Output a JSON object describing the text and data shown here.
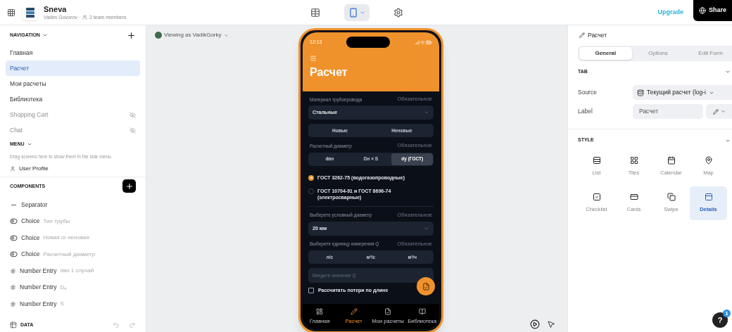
{
  "header": {
    "app_name": "Sneva",
    "owner": "Vadim Govorov ·",
    "team": "2 team members",
    "view_tools": [
      {
        "kind": "table",
        "selected": false
      },
      {
        "kind": "phone",
        "selected": true
      },
      {
        "kind": "gear",
        "selected": false
      }
    ],
    "upgrade": "Upgrade",
    "share": "Share"
  },
  "sidebar": {
    "navigation": {
      "title": "NAVIGATION",
      "items": [
        {
          "label": "Главная",
          "selected": false,
          "hidden": false
        },
        {
          "label": "Расчет",
          "selected": true,
          "hidden": false
        },
        {
          "label": "Мои расчеты",
          "selected": false,
          "hidden": false
        },
        {
          "label": "Библиотека",
          "selected": false,
          "hidden": false
        },
        {
          "label": "Shopping Cart",
          "selected": false,
          "hidden": true
        },
        {
          "label": "Chat",
          "selected": false,
          "hidden": true
        }
      ]
    },
    "menu": {
      "title": "MENU",
      "hint": "Drag screens here to show them in the side menu.",
      "items": [
        "User Profile"
      ]
    },
    "components": {
      "title": "COMPONENTS",
      "items": [
        {
          "kind": "separator",
          "label": "Separator"
        },
        {
          "kind": "choice",
          "label": "Choice",
          "detail": "Тип трубы"
        },
        {
          "kind": "choice",
          "label": "Choice",
          "detail": "Новая or неновая"
        },
        {
          "kind": "choice",
          "label": "Choice",
          "detail": "Расчетный диаметр"
        },
        {
          "kind": "number",
          "label": "Number Entry",
          "detail": "dвн 1 случай"
        },
        {
          "kind": "number",
          "label": "Number Entry",
          "detail": "D$_{н}$"
        },
        {
          "kind": "number",
          "label": "Number Entry",
          "detail": "S"
        }
      ]
    },
    "data": "DATA"
  },
  "canvas": {
    "viewing": "Viewing as VadikGorky"
  },
  "phone": {
    "time": "12:13",
    "title": "Расчет",
    "fields": [
      {
        "kind": "select",
        "label": "Материал трубопровода",
        "required": "Обязательное",
        "value": "Стальные"
      },
      {
        "kind": "segments",
        "options": [
          {
            "label": "Новые",
            "selected": false
          },
          {
            "label": "Неновые",
            "selected": false
          }
        ]
      },
      {
        "kind": "segments",
        "label": "Расчетный диаметр",
        "required": "Обязательное",
        "options": [
          {
            "label": "dвн",
            "selected": false
          },
          {
            "label": "Dн × S",
            "selected": false
          },
          {
            "label": "dy (ГОСТ)",
            "selected": true
          }
        ]
      },
      {
        "kind": "radios",
        "options": [
          {
            "label": "ГОСТ 3262-75 (водогазопроводные)",
            "selected": true
          },
          {
            "label": "ГОСТ 10704-91 и ГОСТ 8696-74 (электросварные)",
            "selected": false
          }
        ]
      },
      {
        "kind": "select",
        "label": "Выберете условный диаметр",
        "required": "Обязательное",
        "value": "20 мм"
      },
      {
        "kind": "segments",
        "label": "Выберите единицу измерения Q",
        "required": "Обязательное",
        "options": [
          {
            "label": "л/с",
            "selected": false
          },
          {
            "label": "м³/с",
            "selected": false
          },
          {
            "label": "м³/ч",
            "selected": false
          }
        ]
      },
      {
        "kind": "input",
        "placeholder": "Введите значение Q"
      },
      {
        "kind": "checkbox",
        "label": "Рассчитать потери по длине",
        "checked": false
      }
    ],
    "tabs": [
      {
        "label": "Главная",
        "selected": false
      },
      {
        "label": "Расчет",
        "selected": true
      },
      {
        "label": "Мои расчеты",
        "selected": false
      },
      {
        "label": "Библиотека",
        "selected": false
      }
    ]
  },
  "panel": {
    "title": "Расчет",
    "tabs": [
      {
        "label": "General",
        "selected": true
      },
      {
        "label": "Options",
        "selected": false
      },
      {
        "label": "Edit Form",
        "selected": false
      }
    ],
    "tab_section": "TAB",
    "source_label": "Source",
    "source_value": "Текущий расчет (log-i",
    "label_label": "Label",
    "label_value": "Расчет",
    "style_section": "STYLE",
    "styles": [
      {
        "kind": "list",
        "label": "List",
        "selected": false
      },
      {
        "kind": "tiles",
        "label": "Tiles",
        "selected": false
      },
      {
        "kind": "calendar",
        "label": "Calendar",
        "selected": false
      },
      {
        "kind": "map",
        "label": "Map",
        "selected": false
      },
      {
        "kind": "checklist",
        "label": "Checklist",
        "selected": false
      },
      {
        "kind": "cards",
        "label": "Cards",
        "selected": false
      },
      {
        "kind": "swipe",
        "label": "Swipe",
        "selected": false
      },
      {
        "kind": "details",
        "label": "Details",
        "selected": true
      }
    ]
  },
  "help": {
    "label": "?",
    "badge": "1"
  }
}
